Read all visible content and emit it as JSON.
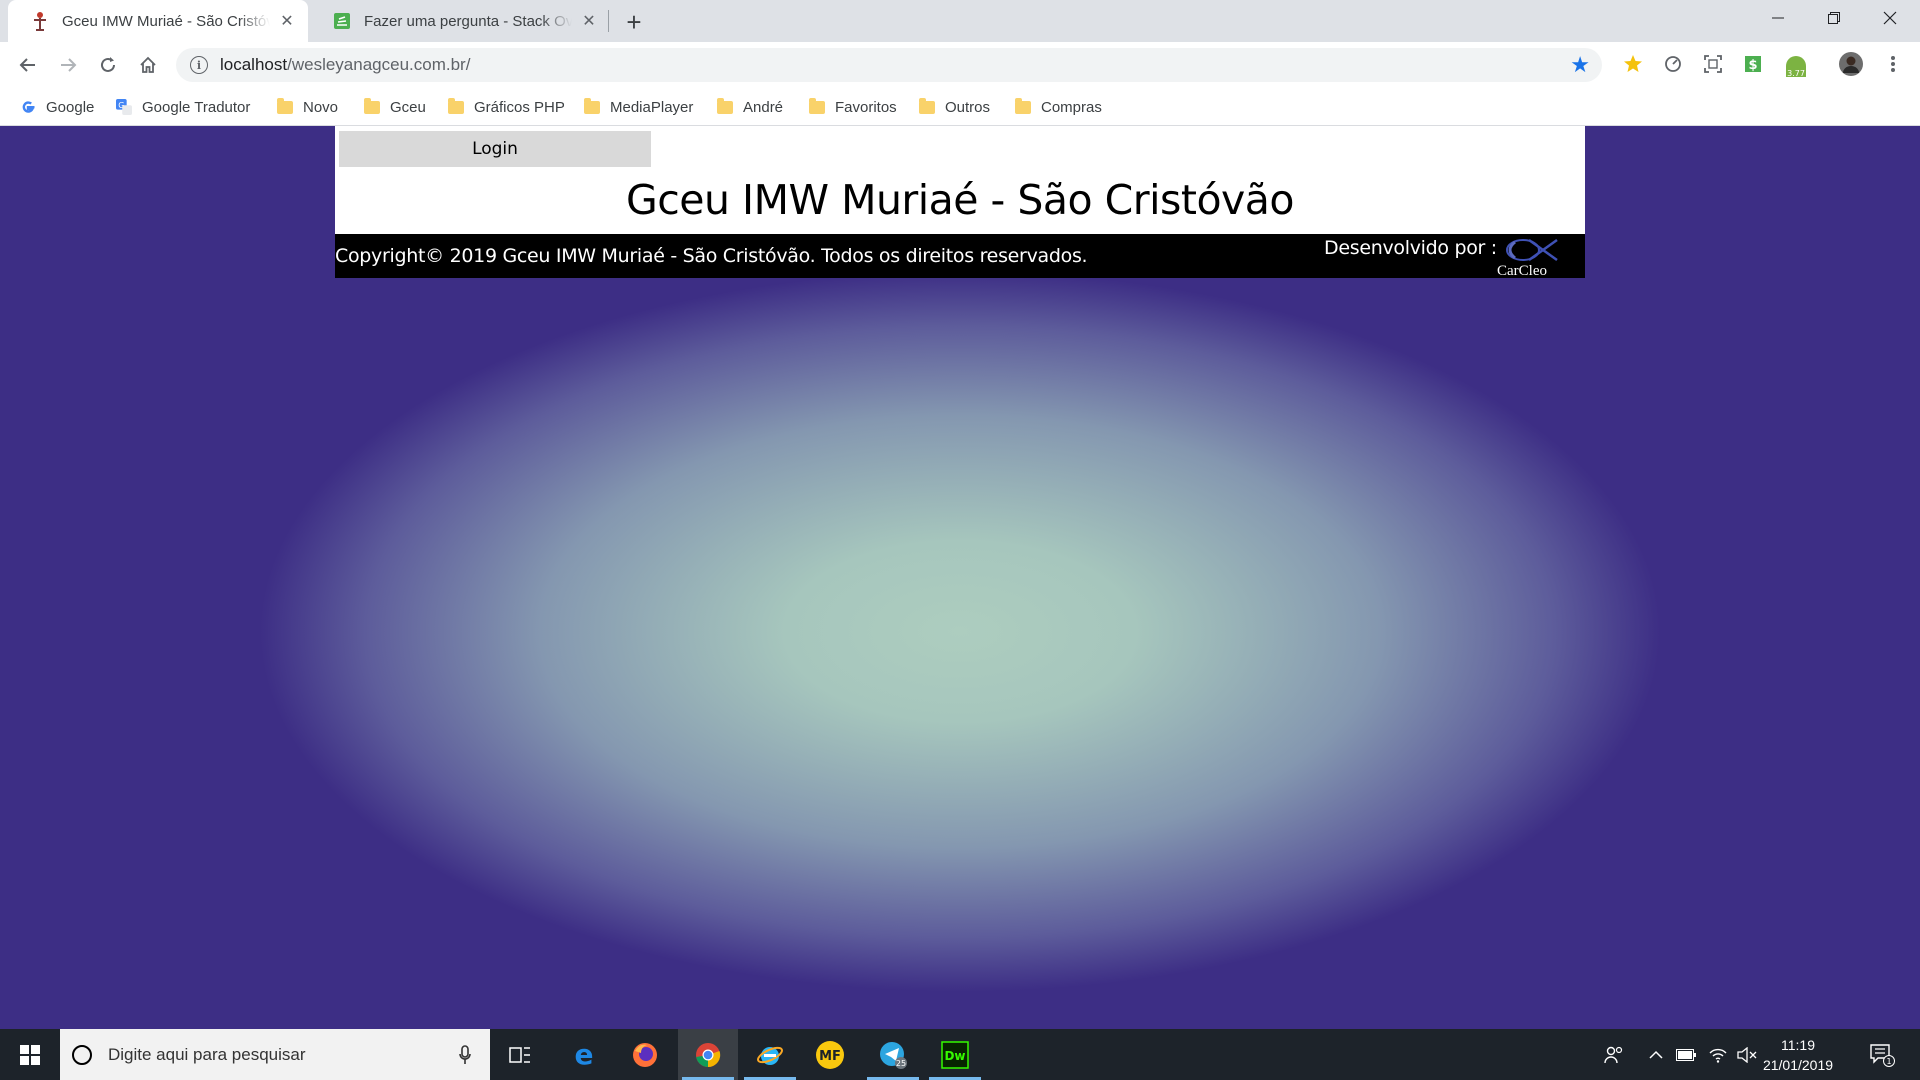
{
  "browser": {
    "tabs": [
      {
        "title": "Gceu IMW Muriaé - São Cristóvão",
        "active": true
      },
      {
        "title": "Fazer uma pergunta - Stack Overflow",
        "active": false
      }
    ],
    "address": {
      "host": "localhost",
      "path": "/wesleyanagceu.com.br/"
    },
    "extension_badge": "3.77",
    "bookmarks": [
      "Google",
      "Google Tradutor",
      "Novo",
      "Gceu",
      "Gráficos PHP",
      "MediaPlayer",
      "André",
      "Favoritos",
      "Outros",
      "Compras"
    ]
  },
  "page": {
    "login_label": "Login",
    "title": "Gceu IMW Muriaé - São Cristóvão",
    "copyright": "Copyright© 2019 Gceu IMW Muriaé - São Cristóvão. Todos os direitos reservados.",
    "developed_by": "Desenvolvido por :",
    "dev_logo_text": "CarCleo"
  },
  "taskbar": {
    "search_placeholder": "Digite aqui para pesquisar",
    "apps": [
      "task-view",
      "edge",
      "firefox",
      "chrome",
      "ie",
      "mf",
      "telegram",
      "dreamweaver"
    ],
    "mf_label": "MF",
    "dw_label": "Dw",
    "telegram_badge": "25",
    "time": "11:19",
    "date": "21/01/2019",
    "notification_count": "1"
  },
  "colors": {
    "page_bg_center": "#adcdbf",
    "page_bg_edge": "#3d2e85",
    "footer_bg": "#000000",
    "login_bg": "#d9d9d9",
    "bookmark_star": "#1a73e8"
  }
}
